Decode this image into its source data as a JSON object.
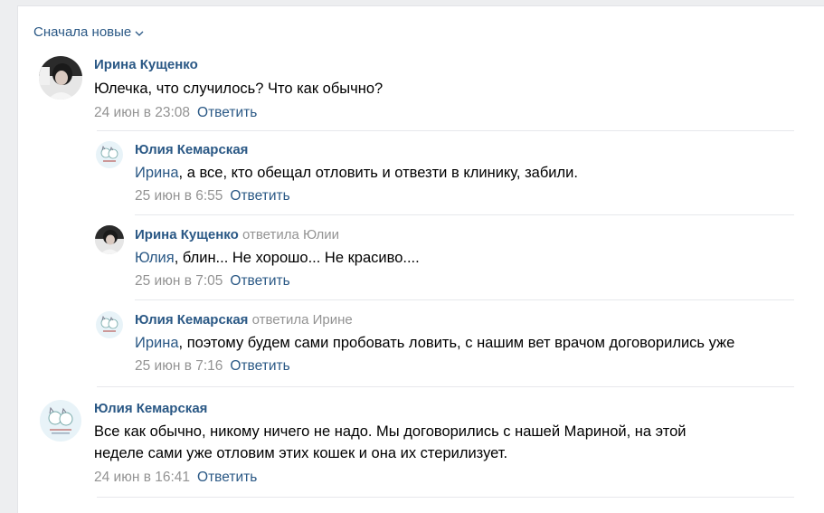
{
  "sort": {
    "label": "Сначала новые",
    "icon": "chevron-down-icon"
  },
  "reply_label": "Ответить",
  "comments": [
    {
      "author": "Ирина Кущенко",
      "text": "Юлечка, что случилось? Что как обычно?",
      "date": "24 июн в 23:08"
    },
    {
      "author": "Юлия Кемарская",
      "mention": "Ирина",
      "text": ", а все, кто обещал отловить и отвезти в клинику, забили.",
      "date": "25 июн в 6:55"
    },
    {
      "author": "Ирина Кущенко",
      "reply_to": "ответила Юлии",
      "mention": "Юлия",
      "text": ", блин... Не хорошо... Не красиво....",
      "date": "25 июн в 7:05"
    },
    {
      "author": "Юлия Кемарская",
      "reply_to": "ответила Ирине",
      "mention": "Ирина",
      "text": ", поэтому будем сами пробовать ловить, с нашим вет врачом договорились уже",
      "date": "25 июн в 7:16"
    },
    {
      "author": "Юлия Кемарская",
      "text_line1": "Все как обычно, никому ничего не надо. Мы договорились с нашей Мариной, на этой",
      "text_line2": "неделе сами уже отловим этих кошек и она их стерилизует.",
      "date": "24 июн в 16:41"
    }
  ],
  "colors": {
    "link": "#2a5885",
    "muted": "#939393",
    "background": "#edeef0"
  }
}
